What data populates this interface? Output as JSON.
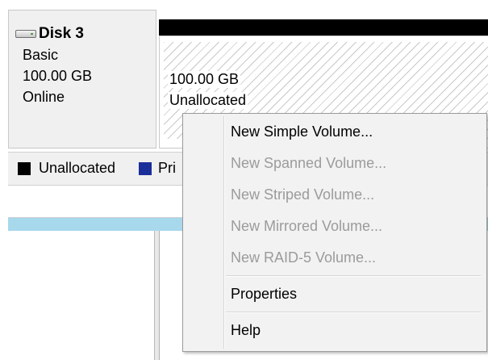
{
  "disk": {
    "icon": "disk-drive-icon",
    "name": "Disk 3",
    "type": "Basic",
    "size": "100.00 GB",
    "status": "Online"
  },
  "partition": {
    "size": "100.00 GB",
    "state": "Unallocated"
  },
  "legend": {
    "items": [
      {
        "label": "Unallocated",
        "color": "#000000"
      },
      {
        "label": "Pri",
        "color": "#1b2f9a"
      }
    ]
  },
  "context_menu": {
    "items": [
      {
        "label": "New Simple Volume...",
        "enabled": true
      },
      {
        "label": "New Spanned Volume...",
        "enabled": false
      },
      {
        "label": "New Striped Volume...",
        "enabled": false
      },
      {
        "label": "New Mirrored Volume...",
        "enabled": false
      },
      {
        "label": "New RAID-5 Volume...",
        "enabled": false
      },
      {
        "label": "Properties",
        "enabled": true
      },
      {
        "label": "Help",
        "enabled": true
      }
    ]
  }
}
